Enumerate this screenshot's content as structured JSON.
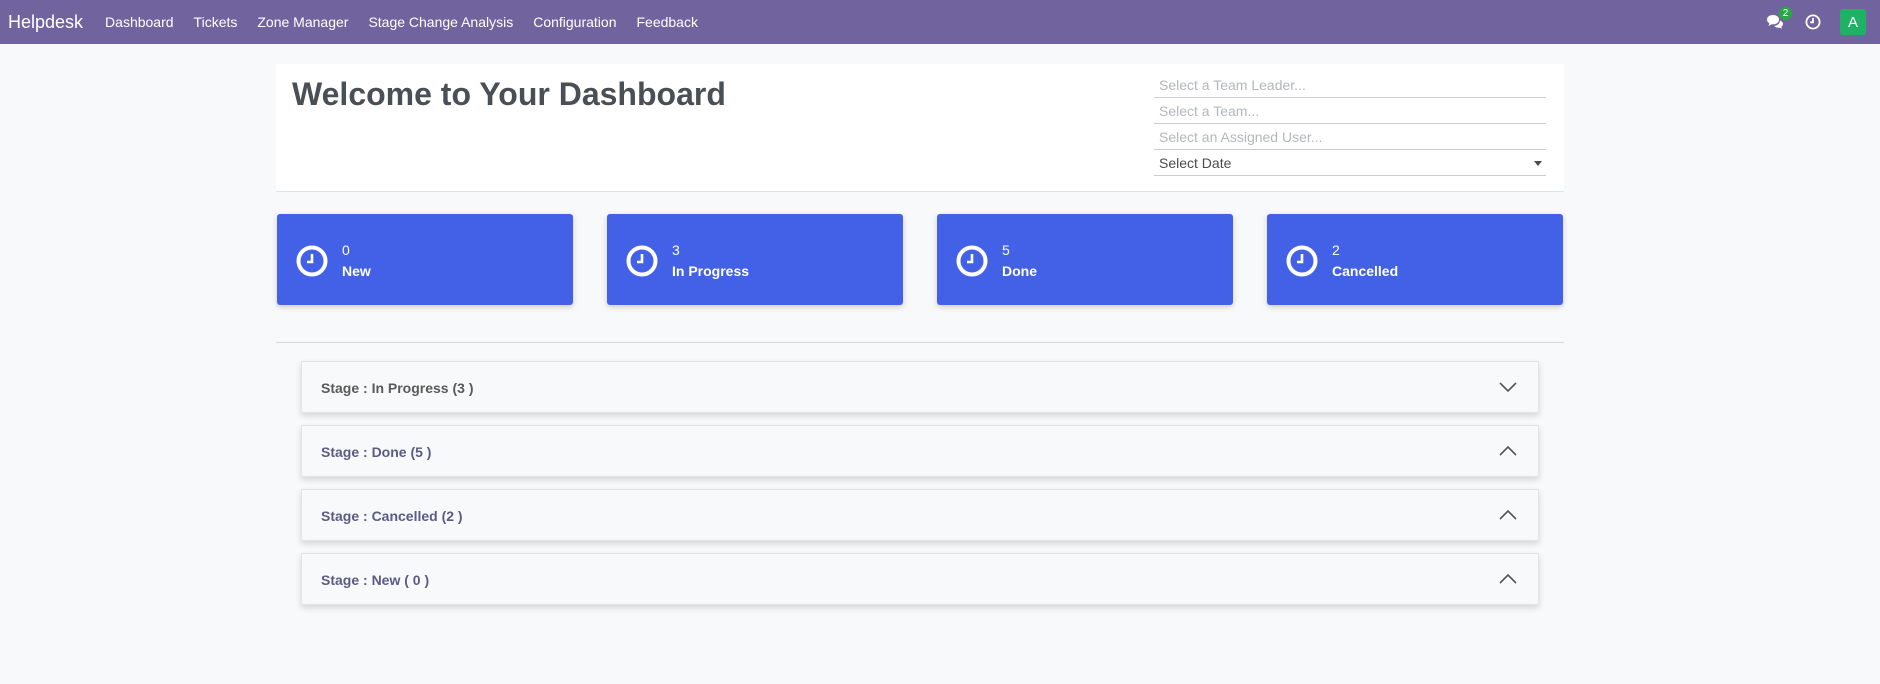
{
  "navbar": {
    "brand": "Helpdesk",
    "menu": [
      "Dashboard",
      "Tickets",
      "Zone Manager",
      "Stage Change Analysis",
      "Configuration",
      "Feedback"
    ],
    "chat_badge": "2",
    "avatar_letter": "A"
  },
  "header": {
    "title": "Welcome to Your Dashboard",
    "filters": {
      "team_leader_placeholder": "Select a Team Leader...",
      "team_placeholder": "Select a Team...",
      "assigned_user_placeholder": "Select an Assigned User...",
      "date_value": "Select Date"
    }
  },
  "cards": [
    {
      "count": "0",
      "label": "New"
    },
    {
      "count": "3",
      "label": "In Progress"
    },
    {
      "count": "5",
      "label": "Done"
    },
    {
      "count": "2",
      "label": "Cancelled"
    }
  ],
  "stages": [
    {
      "label": "Stage : In Progress (3 )",
      "expanded": true
    },
    {
      "label": "Stage : Done (5 )",
      "expanded": false
    },
    {
      "label": "Stage : Cancelled (2 )",
      "expanded": false
    },
    {
      "label": "Stage : New ( 0 )",
      "expanded": false
    }
  ],
  "colors": {
    "navbar": "#71639e",
    "card": "#4361e7",
    "badge": "#28a745",
    "avatar": "#20b264"
  }
}
